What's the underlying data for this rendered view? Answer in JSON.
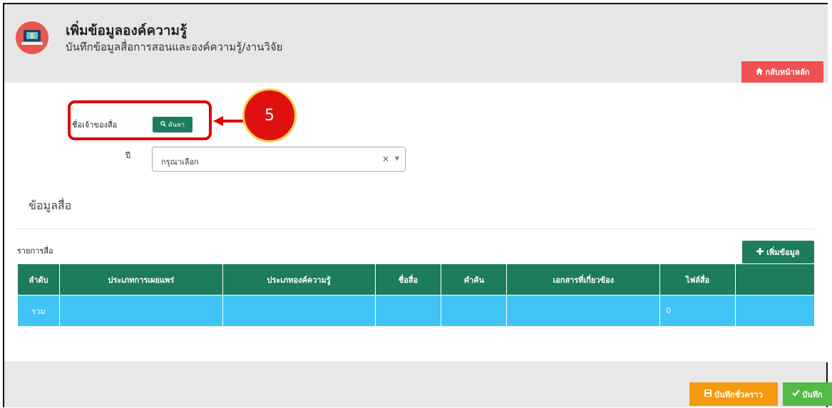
{
  "header": {
    "title": "เพิ่มข้อมูลองค์ความรู้",
    "subtitle": "บันทึกข้อมูลสื่อการสอนและองค์ความรู้/งานวิจัย",
    "home_label": "กลับหน้าหลัก",
    "home_icon": "home-icon"
  },
  "form": {
    "owner_label": "ชื่อเจ้าของสื่อ",
    "search_label": "ค้นหา",
    "search_icon": "search-icon",
    "year_label": "ปี",
    "year_value": "กรุณาเลือก",
    "clear_symbol": "×",
    "caret_symbol": "▼"
  },
  "callout": {
    "number": "5"
  },
  "media": {
    "section_title": "ข้อมูลสื่อ",
    "list_title": "รายการสื่อ",
    "add_label": "เพิ่มข้อมูล",
    "add_icon": "plus-icon",
    "columns": [
      "ลำดับ",
      "ประเภทการเผยแพร่",
      "ประเภทองค์ความรู้",
      "ชื่อสื่อ",
      "คำค้น",
      "เอกสารที่เกี่ยวข้อง",
      "ไฟล์สื่อ",
      ""
    ],
    "total_row": [
      "รวม",
      "",
      "",
      "",
      "",
      "",
      "0",
      ""
    ]
  },
  "footer": {
    "save_draft_label": "บันทึกชั่วคราว",
    "save_label": "บันทึก"
  },
  "colors": {
    "accent_green": "#1d7b5e",
    "row_blue": "#3fc4f5",
    "danger_red": "#f05050",
    "warning_orange": "#f59a0f",
    "success_green": "#54b948"
  }
}
